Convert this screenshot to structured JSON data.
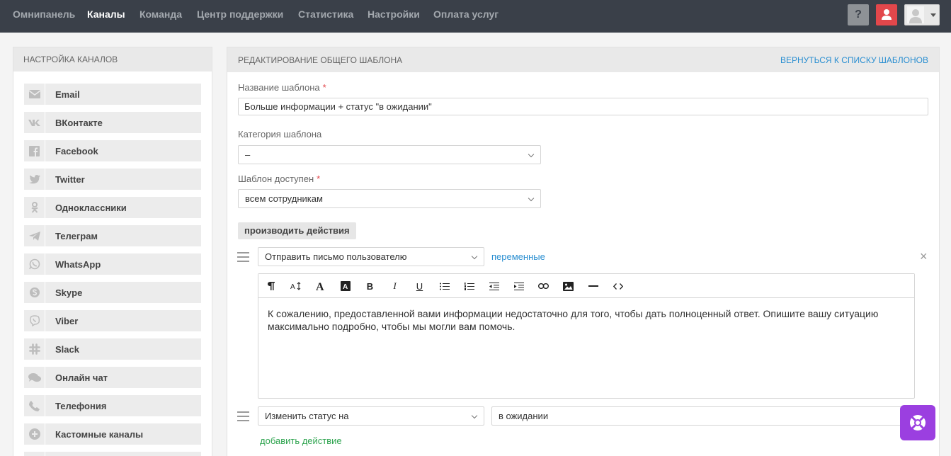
{
  "nav": {
    "items": [
      {
        "label": "Омнипанель"
      },
      {
        "label": "Каналы"
      },
      {
        "label": "Команда"
      },
      {
        "label": "Центр поддержки"
      },
      {
        "label": "Статистика"
      },
      {
        "label": "Настройки"
      },
      {
        "label": "Оплата услуг"
      }
    ],
    "active": "Каналы",
    "help_label": "?"
  },
  "sidebar": {
    "title": "Настройка каналов",
    "items": [
      {
        "label": "Email",
        "icon": "envelope-icon"
      },
      {
        "label": "ВКонтакте",
        "icon": "vk-icon"
      },
      {
        "label": "Facebook",
        "icon": "facebook-icon"
      },
      {
        "label": "Twitter",
        "icon": "twitter-icon"
      },
      {
        "label": "Одноклассники",
        "icon": "odnoklassniki-icon"
      },
      {
        "label": "Телеграм",
        "icon": "telegram-icon"
      },
      {
        "label": "WhatsApp",
        "icon": "whatsapp-icon"
      },
      {
        "label": "Skype",
        "icon": "skype-icon"
      },
      {
        "label": "Viber",
        "icon": "viber-icon"
      },
      {
        "label": "Slack",
        "icon": "slack-icon"
      },
      {
        "label": "Онлайн чат",
        "icon": "chat-icon"
      },
      {
        "label": "Телефония",
        "icon": "phone-icon"
      },
      {
        "label": "Кастомные каналы",
        "icon": "plus-circle-icon"
      }
    ]
  },
  "main": {
    "title": "Редактирование общего шаблона",
    "back_link": "Вернуться к списку шаблонов",
    "name_label": "Название шаблона",
    "name_value": "Больше информации + статус \"в ожидании\"",
    "category_label": "Категория шаблона",
    "category_value": "–",
    "access_label": "Шаблон доступен",
    "access_value": "всем сотрудникам",
    "required_mark": "*",
    "actions_button": "производить действия",
    "action1_select": "Отправить письмо пользователю",
    "variables_link": "переменные",
    "close_symbol": "×",
    "editor_text": "К сожалению, предоставленной вами информации недостаточно для того, чтобы дать полноценный ответ. Опишите вашу ситуацию максимально подробно, чтобы мы могли вам помочь.",
    "action2_select": "Изменить статус на",
    "action2_value": "в ожидании",
    "add_action": "добавить действие"
  },
  "colors": {
    "topbar": "#3a4049",
    "accent_blue": "#2b8fd1",
    "user_red": "#e2474b",
    "add_green": "#2ea44f",
    "fab_purple": "#9b3fe0"
  }
}
